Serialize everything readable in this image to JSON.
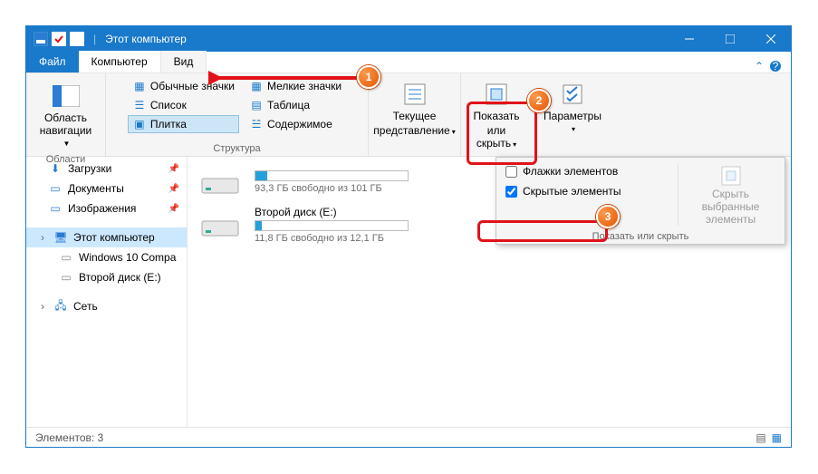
{
  "window": {
    "title": "Этот компьютер"
  },
  "tabs": {
    "file": "Файл",
    "computer": "Компьютер",
    "view": "Вид"
  },
  "ribbon": {
    "nav_pane": "Область навигации",
    "nav_group": "Области",
    "layout_group": "Структура",
    "opts": {
      "normal": "Обычные значки",
      "small": "Мелкие значки",
      "list": "Список",
      "table": "Таблица",
      "tiles": "Плитка",
      "content": "Содержимое"
    },
    "current_view_l1": "Текущее",
    "current_view_l2": "представление",
    "show_hide_l1": "Показать",
    "show_hide_l2": "или скрыть",
    "options": "Параметры"
  },
  "dropdown": {
    "flags": "Флажки элементов",
    "hidden": "Скрытые элементы",
    "hide_sel_l1": "Скрыть выбранные",
    "hide_sel_l2": "элементы",
    "footer": "Показать или скрыть"
  },
  "nav": {
    "downloads": "Загрузки",
    "documents": "Документы",
    "pictures": "Изображения",
    "this_pc": "Этот компьютер",
    "win10": "Windows 10 Compa",
    "drive_e": "Второй диск (E:)",
    "network": "Сеть"
  },
  "drives": [
    {
      "name": "",
      "free": "93,3 ГБ свободно из 101 ГБ",
      "pct": 8
    },
    {
      "name": "Второй диск (E:)",
      "free": "11,8 ГБ свободно из 12,1 ГБ",
      "pct": 4
    }
  ],
  "status": {
    "count": "Элементов: 3"
  },
  "callouts": {
    "c1": "1",
    "c2": "2",
    "c3": "3"
  }
}
